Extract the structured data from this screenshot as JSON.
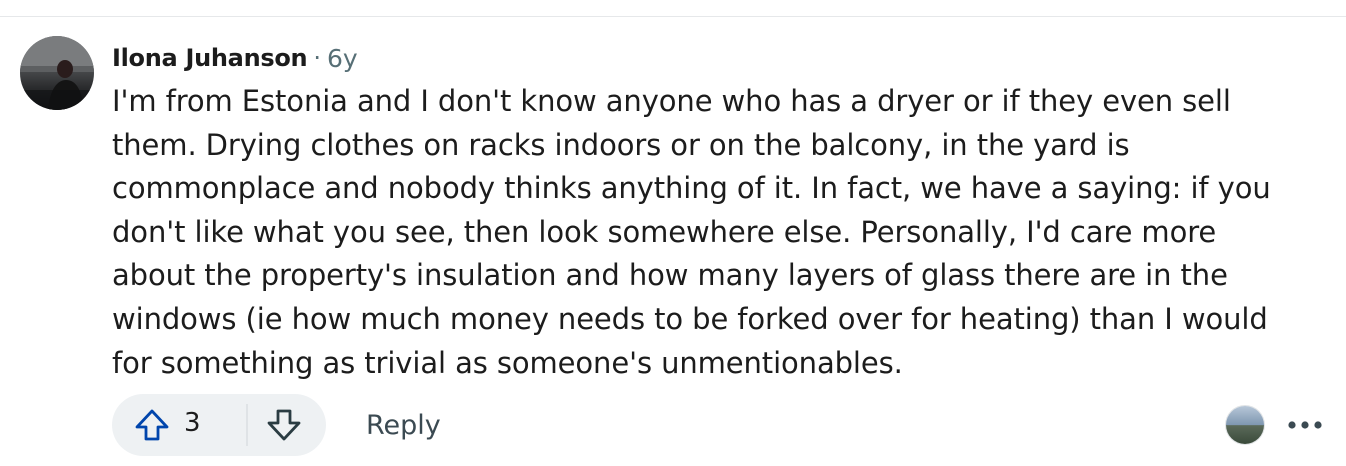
{
  "comment": {
    "author": "Ilona Juhanson",
    "separator": "·",
    "age": "6y",
    "body": "I'm from Estonia and I don't know anyone who has a dryer or if they even sell\nthem. Drying clothes on racks indoors or on the balcony, in the yard is\ncommonplace and nobody thinks anything of it. In fact, we have a saying: if you\ndon't like what you see, then look somewhere else. Personally, I'd care more\nabout the property's insulation and how many layers of glass there are in the\nwindows (ie how much money needs to be forked over for heating) than I would\nfor something as trivial as someone's unmentionables."
  },
  "actions": {
    "vote_count": "3",
    "reply_label": "Reply",
    "more_label": "•••"
  },
  "icons": {
    "upvote": "arrow-up-outline-icon",
    "downvote": "arrow-down-outline-icon",
    "more": "more-horizontal-icon"
  },
  "colors": {
    "upvote_accent": "#0045ac",
    "meta_gray": "#576f76",
    "pill_bg": "#eef1f3"
  }
}
